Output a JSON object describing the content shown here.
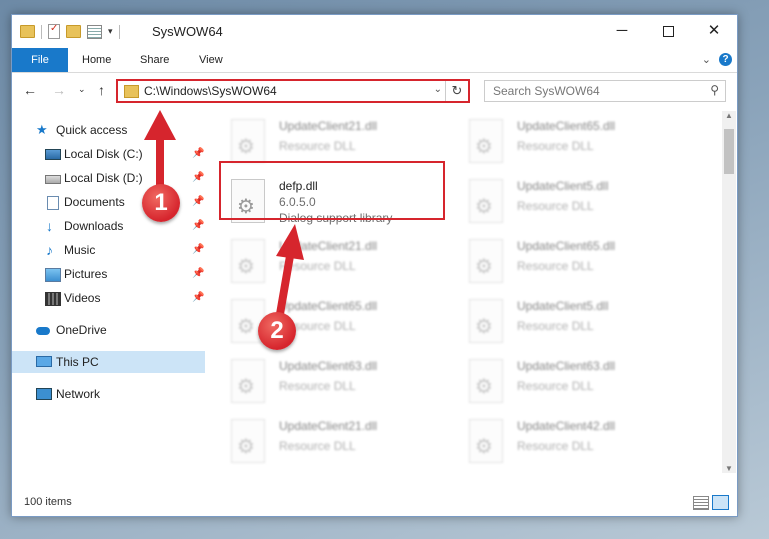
{
  "window": {
    "title": "SysWOW64",
    "controls": {
      "minimize": "─",
      "close": "✕"
    }
  },
  "ribbon": {
    "tabs": [
      "File",
      "Home",
      "Share",
      "View"
    ],
    "expand": "⌄",
    "help": "?"
  },
  "nav": {
    "back": "←",
    "forward": "→",
    "recent": "⌄",
    "up": "↑",
    "address": "C:\\Windows\\SysWOW64",
    "address_dropdown": "⌄",
    "refresh": "↻",
    "search_placeholder": "Search SysWOW64"
  },
  "navpane": {
    "items": [
      {
        "label": "Quick access",
        "icon": "quick-access-star-icon"
      },
      {
        "label": "Local Disk (C:)",
        "icon": "local-disk-icon",
        "pinned": true
      },
      {
        "label": "Local Disk (D:)",
        "icon": "local-disk-icon",
        "pinned": true
      },
      {
        "label": "Documents",
        "icon": "documents-icon",
        "pinned": true
      },
      {
        "label": "Downloads",
        "icon": "downloads-icon",
        "pinned": true
      },
      {
        "label": "Music",
        "icon": "music-icon",
        "pinned": true
      },
      {
        "label": "Pictures",
        "icon": "pictures-icon",
        "pinned": true
      },
      {
        "label": "Videos",
        "icon": "videos-icon",
        "pinned": true
      },
      {
        "label": "OneDrive",
        "icon": "onedrive-icon"
      },
      {
        "label": "This PC",
        "icon": "this-pc-icon",
        "selected": true
      },
      {
        "label": "Network",
        "icon": "network-icon"
      }
    ],
    "pin_glyph": "📌"
  },
  "files": {
    "left_column": [
      {
        "name": "UpdateClient21.dll",
        "type": "Resource DLL"
      },
      {
        "name": "defp.dll",
        "version": "6.0.5.0",
        "type": "Dialog support library",
        "highlighted": true
      },
      {
        "name": "UpdateClient21.dll",
        "type": "Resource DLL"
      },
      {
        "name": "UpdateClient65.dll",
        "type": "Resource DLL"
      },
      {
        "name": "UpdateClient63.dll",
        "type": "Resource DLL"
      },
      {
        "name": "UpdateClient21.dll",
        "type": "Resource DLL"
      }
    ],
    "right_column": [
      {
        "name": "UpdateClient65.dll",
        "type": "Resource DLL"
      },
      {
        "name": "UpdateClient5.dll",
        "type": "Resource DLL"
      },
      {
        "name": "UpdateClient65.dll",
        "type": "Resource DLL"
      },
      {
        "name": "UpdateClient5.dll",
        "type": "Resource DLL"
      },
      {
        "name": "UpdateClient63.dll",
        "type": "Resource DLL"
      },
      {
        "name": "UpdateClient42.dll",
        "type": "Resource DLL"
      }
    ]
  },
  "status": {
    "item_count": "100 items"
  },
  "annotations": {
    "step1": "1",
    "step2": "2",
    "color": "#d6252d"
  }
}
